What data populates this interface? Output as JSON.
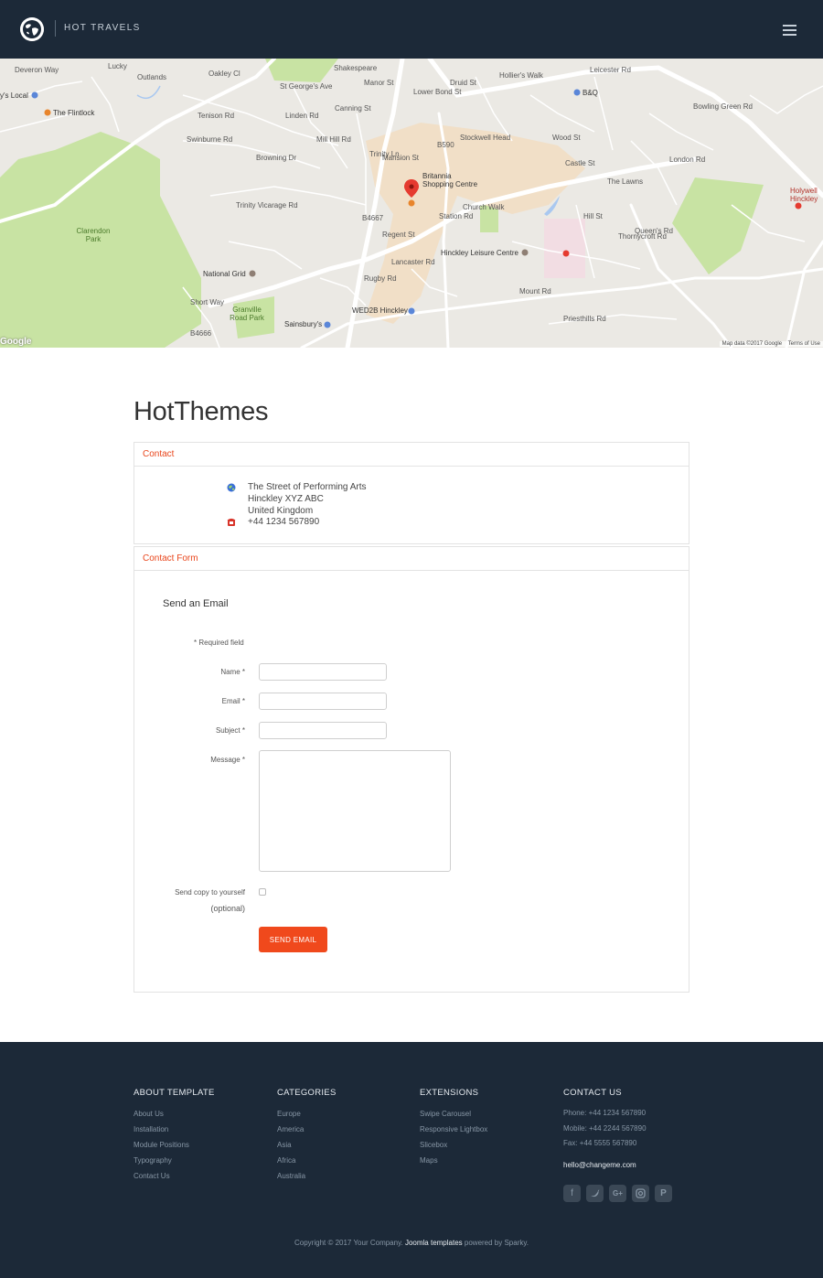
{
  "header": {
    "brand": "HOT TRAVELS",
    "logo_icon": "globe-icon",
    "menu_icon": "hamburger-icon"
  },
  "map": {
    "labels": [
      "Deveron Way",
      "Lucky",
      "Outlands",
      "Oakley Cl",
      "St George's Ave",
      "Shakespeare",
      "Manor St",
      "Lower Bond St",
      "Druid St",
      "Hollier's Walk",
      "Leicester Rd",
      "Tenison Rd",
      "Linden Rd",
      "Canning St",
      "Swinburne Rd",
      "Browning Dr",
      "Mill Hill Rd",
      "Trinity Ln",
      "Mansion St",
      "B590",
      "Stockwell Head",
      "Wood St",
      "Castle St",
      "Trinity Vicarage Rd",
      "Church Walk",
      "Regent St",
      "Lancaster Rd",
      "Station Rd",
      "Hill St",
      "The Lawns",
      "Thornycroft Rd",
      "Queen's Rd",
      "London Rd",
      "Bowling Green Rd",
      "Clarendon Park",
      "Granville Road Park",
      "Priesthills Rd",
      "Mount Rd",
      "Rugby Rd",
      "B4667",
      "B4666",
      "Short Way"
    ],
    "pois": [
      "y's Local",
      "The Flintlock",
      "Britannia Shopping Centre",
      "Hinckley Leisure Centre",
      "National Grid",
      "WED2B Hinckley",
      "Sainsbury's",
      "B&Q",
      "Holywell Hinckley"
    ],
    "attribution": "Map data ©2017 Google",
    "terms": "Terms of Use",
    "google": "Google"
  },
  "page": {
    "title": "HotThemes"
  },
  "contact": {
    "heading": "Contact",
    "address": [
      "The Street of Performing Arts",
      "Hinckley XYZ ABC",
      "United Kingdom"
    ],
    "phone": "+44 1234 567890"
  },
  "form": {
    "heading": "Contact Form",
    "title": "Send an Email",
    "required_note": "* Required field",
    "name_label": "Name *",
    "email_label": "Email *",
    "subject_label": "Subject *",
    "message_label": "Message *",
    "copy_label": "Send copy to yourself",
    "copy_optional": "(optional)",
    "submit": "SEND EMAIL"
  },
  "footer": {
    "col1": {
      "title": "ABOUT TEMPLATE",
      "links": [
        "About Us",
        "Installation",
        "Module Positions",
        "Typography",
        "Contact Us"
      ]
    },
    "col2": {
      "title": "CATEGORIES",
      "links": [
        "Europe",
        "America",
        "Asia",
        "Africa",
        "Australia"
      ]
    },
    "col3": {
      "title": "EXTENSIONS",
      "links": [
        "Swipe Carousel",
        "Responsive Lightbox",
        "Slicebox",
        "Maps"
      ]
    },
    "col4": {
      "title": "CONTACT US",
      "phone": "Phone: +44 1234 567890",
      "mobile": "Mobile: +44 2244 567890",
      "fax": "Fax: +44 5555 567890",
      "email": "hello@changeme.com"
    },
    "socials": [
      "facebook-icon",
      "twitter-icon",
      "google-plus-icon",
      "instagram-icon",
      "pinterest-icon"
    ],
    "copyright_pre": "Copyright © 2017 Your Company.",
    "copyright_link": "Joomla templates",
    "copyright_post": "powered by Sparky."
  },
  "colors": {
    "header_bg": "#1c2938",
    "accent": "#f0491c",
    "panel_heading": "#e9461c",
    "park": "#c8e3a3"
  }
}
